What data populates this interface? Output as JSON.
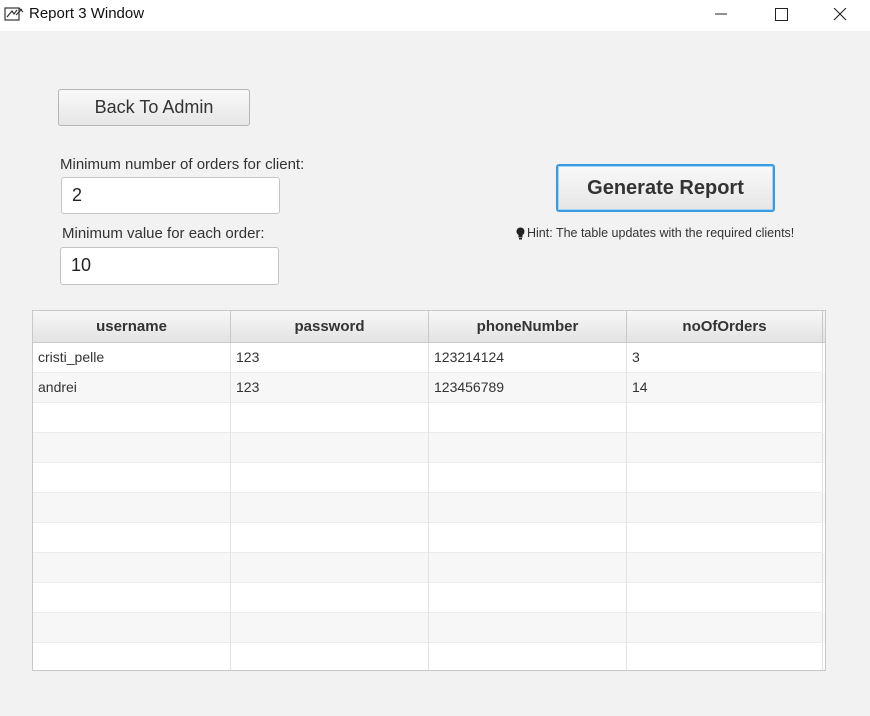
{
  "window": {
    "title": "Report 3 Window",
    "icon": "java-app-icon",
    "controls": [
      "minimize-icon",
      "maximize-icon",
      "close-icon"
    ]
  },
  "buttons": {
    "back": "Back To Admin",
    "generate": "Generate Report"
  },
  "form": {
    "min_orders_label": "Minimum number of orders for client:",
    "min_orders_value": "2",
    "min_value_label": "Minimum value for each order:",
    "min_value_value": "10"
  },
  "hint": {
    "icon": "lightbulb-icon",
    "text": "Hint: The table updates with the required clients!"
  },
  "table": {
    "columns": [
      "username",
      "password",
      "phoneNumber",
      "noOfOrders"
    ],
    "rows": [
      [
        "cristi_pelle",
        "123",
        "123214124",
        "3"
      ],
      [
        "andrei",
        "123",
        "123456789",
        "14"
      ]
    ]
  },
  "colors": {
    "background": "#f2f2f2",
    "focus_border": "#3a9be0",
    "table_header": "#e3e3e3"
  }
}
